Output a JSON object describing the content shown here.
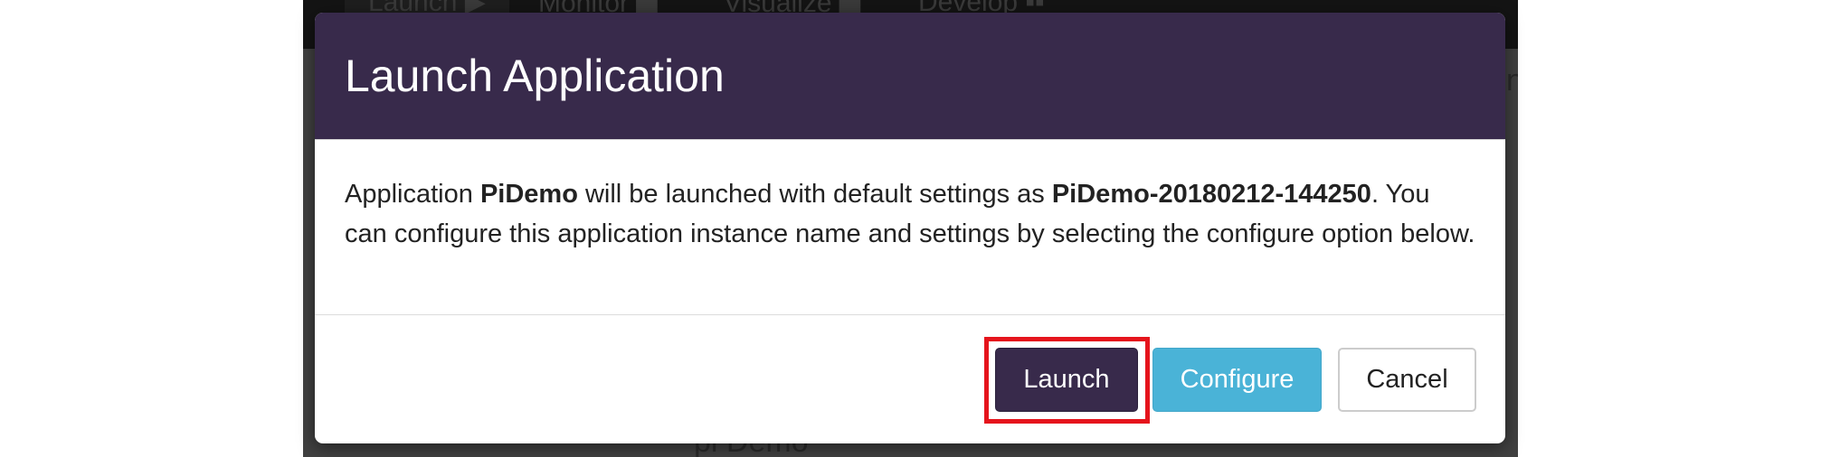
{
  "nav": {
    "items": [
      "Launch ▶",
      "Monitor ▆",
      "Visualize ▆",
      "Develop ▪▪"
    ]
  },
  "background": {
    "partial_text_right": "n",
    "partial_text_bottom": "pi Demo"
  },
  "modal": {
    "title": "Launch Application",
    "body": {
      "prefix": "Application ",
      "app_name": "PiDemo",
      "middle": " will be launched with default settings as ",
      "instance_name": "PiDemo-20180212-144250",
      "suffix": ". You can configure this application instance name and settings by selecting the configure option below."
    },
    "buttons": {
      "launch": "Launch",
      "configure": "Configure",
      "cancel": "Cancel"
    }
  },
  "colors": {
    "header_bg": "#382a4b",
    "launch_bg": "#382a4b",
    "configure_bg": "#4ab3d7",
    "highlight": "#e5141c"
  }
}
